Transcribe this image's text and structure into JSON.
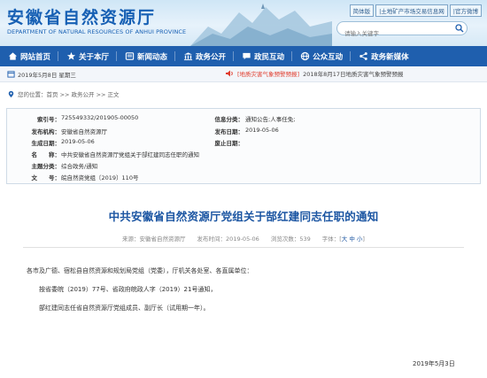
{
  "header": {
    "site_title": "安徽省自然资源厅",
    "site_subtitle": "DEPARTMENT OF NATURAL RESOURCES OF ANHUI PROVINCE",
    "top_links": [
      "简体版",
      "|土地矿产市场交易信息网",
      "|官方微博"
    ],
    "search_placeholder": "请输入关键字"
  },
  "nav": {
    "items": [
      {
        "label": "网站首页",
        "icon": "home-icon"
      },
      {
        "label": "关于本厅",
        "icon": "star-icon"
      },
      {
        "label": "新闻动态",
        "icon": "news-icon"
      },
      {
        "label": "政务公开",
        "icon": "building-icon"
      },
      {
        "label": "政民互动",
        "icon": "chat-icon"
      },
      {
        "label": "公众互动",
        "icon": "globe-icon"
      },
      {
        "label": "政务新媒体",
        "icon": "share-icon"
      }
    ]
  },
  "infobar": {
    "date_text": "2019年5月8日  星期三",
    "notice_tag": "[地质灾害气象预警预报]",
    "notice_text": "2018年8月17日地质灾害气象预警预报"
  },
  "breadcrumb": "您的位置：首页 >> 政务公开 >> 正文",
  "meta": {
    "index_key": "索引号：",
    "index_val": "725549332/201905-00050",
    "category_key": "信息分类：",
    "category_val": "通知公告;人事任免;",
    "publisher_key": "发布机构：",
    "publisher_val": "安徽省自然资源厅",
    "pubdate_key": "发布日期：",
    "pubdate_val": "2019-05-06",
    "created_key": "生成日期：",
    "created_val": "2019-05-06",
    "expire_key": "废止日期：",
    "expire_val": "",
    "name_key": "名　　称：",
    "name_val": "中共安徽省自然资源厅党组关于郜红建同志任职的通知",
    "topic_key": "主题分类：",
    "topic_val": "综合政务/通知",
    "docno_key": "文　　号：",
    "docno_val": "皖自然资党组〔2019〕110号"
  },
  "article": {
    "title": "中共安徽省自然资源厅党组关于郜红建同志任职的通知",
    "info": "来源：安徽省自然资源厅　　发布时间：2019-05-06　　浏览次数：539　　字体：[",
    "font_size_label": "大 中 小",
    "info_end": "]",
    "salutation": "各市及广德、宿松县自然资源和规划局党组（党委），厅机关各处室、各直属单位：",
    "para1": "　　按省委皖（2019）77号、省政府皖政人字（2019）21号通知，",
    "para2": "　　郜红建同志任省自然资源厅党组成员、副厅长（试用期一年）。",
    "sign_date": "2019年5月3日"
  },
  "colors": {
    "brand_blue": "#1f5fae",
    "title_blue": "#1b55a2",
    "alert_red": "#e03c2c"
  }
}
